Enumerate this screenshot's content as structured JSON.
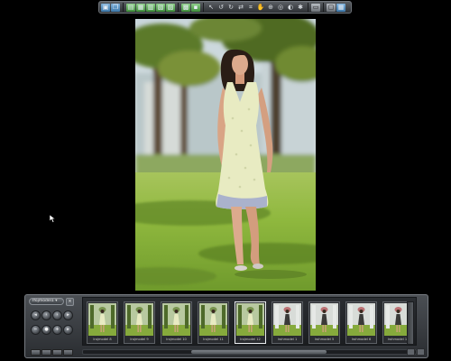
{
  "toolbar": {
    "buttons": [
      {
        "name": "monitor-icon",
        "glyph": "▣",
        "style": "blue"
      },
      {
        "name": "stack-icon",
        "glyph": "❐",
        "style": "blue"
      },
      {
        "name": "sep"
      },
      {
        "name": "folder-open-icon",
        "glyph": "▤",
        "style": "green"
      },
      {
        "name": "image-icon",
        "glyph": "▦",
        "style": "green"
      },
      {
        "name": "folder-icon",
        "glyph": "▥",
        "style": "green"
      },
      {
        "name": "save-icon",
        "glyph": "▧",
        "style": "green"
      },
      {
        "name": "export-icon",
        "glyph": "▨",
        "style": "green"
      },
      {
        "name": "sep"
      },
      {
        "name": "copy-icon",
        "glyph": "▩",
        "style": "green"
      },
      {
        "name": "paste-icon",
        "glyph": "▪",
        "style": "green"
      },
      {
        "name": "sep"
      },
      {
        "name": "pointer-icon",
        "glyph": "↖",
        "style": "plain"
      },
      {
        "name": "rotate-left-icon",
        "glyph": "↺",
        "style": "plain"
      },
      {
        "name": "rotate-right-icon",
        "glyph": "↻",
        "style": "plain"
      },
      {
        "name": "flip-icon",
        "glyph": "⇄",
        "style": "plain"
      },
      {
        "name": "crop-icon",
        "glyph": "⌗",
        "style": "plain"
      },
      {
        "name": "hand-icon",
        "glyph": "✋",
        "style": "plain"
      },
      {
        "name": "zoom-icon",
        "glyph": "⊕",
        "style": "plain"
      },
      {
        "name": "circle-icon",
        "glyph": "◎",
        "style": "plain"
      },
      {
        "name": "color-icon",
        "glyph": "◐",
        "style": "plain"
      },
      {
        "name": "settings-icon",
        "glyph": "✱",
        "style": "plain"
      },
      {
        "name": "sep"
      },
      {
        "name": "fullscreen-icon",
        "glyph": "▭",
        "style": "box"
      },
      {
        "name": "sep"
      },
      {
        "name": "window-icon",
        "glyph": "▢",
        "style": "box"
      },
      {
        "name": "grid-icon",
        "glyph": "▦",
        "style": "blue"
      }
    ]
  },
  "filmstrip": {
    "folder_dropdown": "Ifojmodel1 ▾",
    "close_glyph": "×",
    "nav_buttons": [
      {
        "name": "first-icon",
        "glyph": "◂"
      },
      {
        "name": "prev-icon",
        "glyph": "‹"
      },
      {
        "name": "next-icon",
        "glyph": "›"
      },
      {
        "name": "last-icon",
        "glyph": "▸"
      },
      {
        "name": "zoom-out-icon",
        "glyph": "−"
      },
      {
        "name": "stop-icon",
        "glyph": "●"
      },
      {
        "name": "zoom-in-icon",
        "glyph": "+"
      },
      {
        "name": "play-icon",
        "glyph": "▸"
      }
    ],
    "thumbnails": [
      {
        "label": "Irojmodel 8",
        "model": "light",
        "selected": false
      },
      {
        "label": "Irojmodel 9",
        "model": "light",
        "selected": false
      },
      {
        "label": "Irojmodel 10",
        "model": "light",
        "selected": false
      },
      {
        "label": "Irojmodel 11",
        "model": "light",
        "selected": false
      },
      {
        "label": "Irojmodel 12",
        "model": "light",
        "selected": true
      },
      {
        "label": "Irohmodel 1",
        "model": "dark",
        "selected": false
      },
      {
        "label": "Irohmodel 5",
        "model": "dark",
        "selected": false
      },
      {
        "label": "Irohmodel 6",
        "model": "dark",
        "selected": false
      },
      {
        "label": "Irohmodel 11",
        "model": "dark",
        "selected": false
      }
    ]
  },
  "colors": {
    "background": "#000000",
    "grass": "#8fb83e",
    "dress": "#e8ebc2",
    "hair": "#2a1d16",
    "skin": "#d9a485"
  }
}
